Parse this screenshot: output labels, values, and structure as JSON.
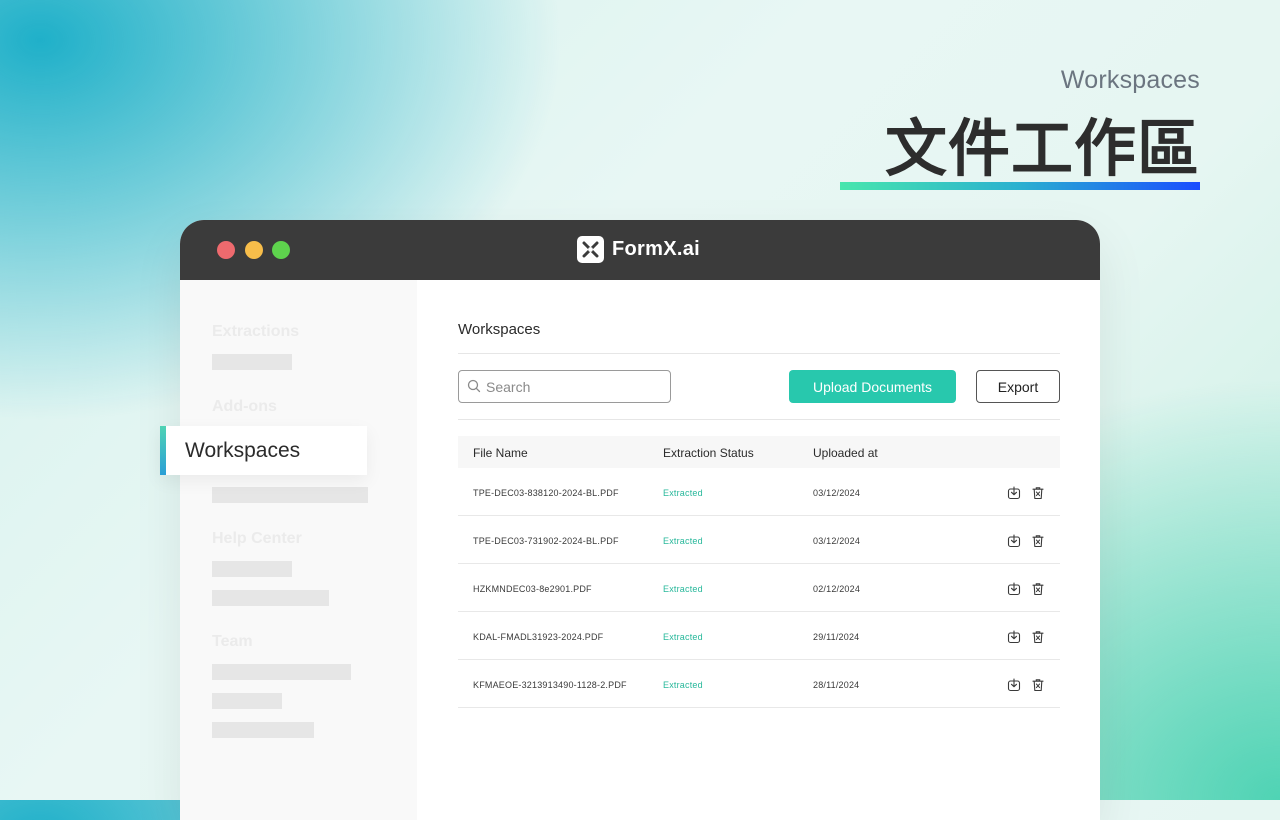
{
  "hero": {
    "subtitle": "Workspaces",
    "title": "文件工作區"
  },
  "window": {
    "brand": "FormX.ai"
  },
  "sidebar": {
    "headings": [
      "Extractions",
      "Add-ons",
      "Help Center",
      "Team"
    ],
    "active_item": "Workspaces"
  },
  "main": {
    "title": "Workspaces",
    "search": {
      "placeholder": "Search"
    },
    "upload_label": "Upload Documents",
    "export_label": "Export",
    "columns": [
      "File Name",
      "Extraction Status",
      "Uploaded at"
    ],
    "rows": [
      {
        "file": "TPE-DEC03-838120-2024-BL.PDF",
        "status": "Extracted",
        "date": "03/12/2024"
      },
      {
        "file": "TPE-DEC03-731902-2024-BL.PDF",
        "status": "Extracted",
        "date": "03/12/2024"
      },
      {
        "file": "HZKMNDEC03-8e2901.PDF",
        "status": "Extracted",
        "date": "02/12/2024"
      },
      {
        "file": "KDAL-FMADL31923-2024.PDF",
        "status": "Extracted",
        "date": "29/11/2024"
      },
      {
        "file": "KFMAEOE-3213913490-1128-2.PDF",
        "status": "Extracted",
        "date": "28/11/2024"
      }
    ]
  },
  "colors": {
    "accent": "#28c8ad",
    "titlebar": "#3b3b3b",
    "status_text": "#28b89b"
  },
  "icons": [
    "search-icon",
    "download-icon",
    "trash-icon",
    "formx-logo-icon"
  ]
}
